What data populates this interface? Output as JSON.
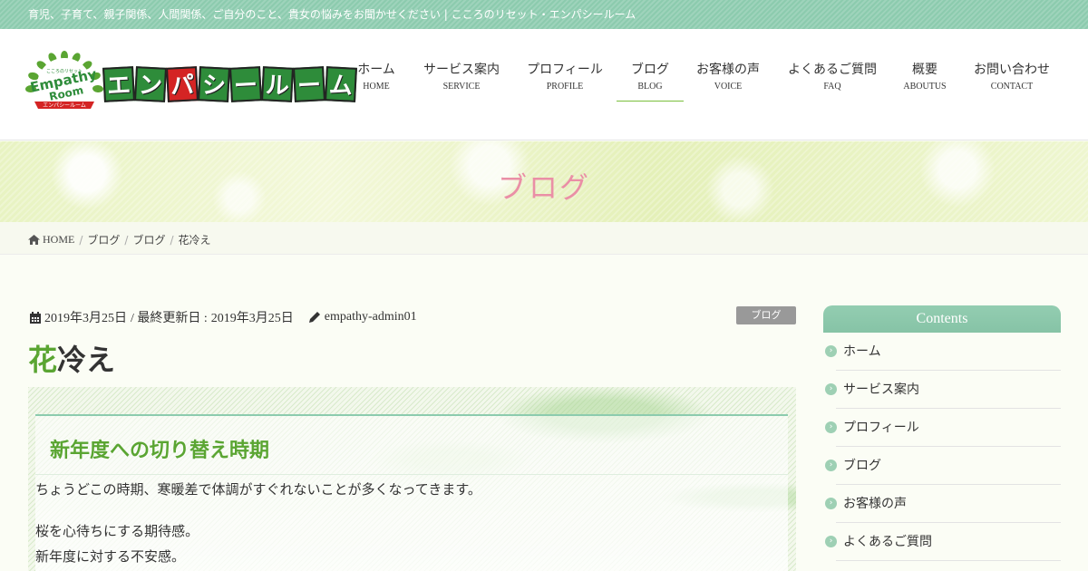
{
  "topbar": {
    "tagline": "育児、子育て、親子関係、人間関係、ご自分のこと、貴女の悩みをお聞かせください | こころのリセット・エンパシールーム"
  },
  "logo": {
    "badge_small": "こころのリセット",
    "badge_line1": "Empathy",
    "badge_line2": "Room",
    "badge_ribbon": "エンパシールーム",
    "wordmark": [
      "エ",
      "ン",
      "パ",
      "シ",
      "ー",
      "ル",
      "ー",
      "ム"
    ]
  },
  "nav": [
    {
      "jp": "ホーム",
      "en": "HOME"
    },
    {
      "jp": "サービス案内",
      "en": "SERVICE"
    },
    {
      "jp": "プロフィール",
      "en": "PROFILE"
    },
    {
      "jp": "ブログ",
      "en": "BLOG",
      "active": true
    },
    {
      "jp": "お客様の声",
      "en": "VOICE"
    },
    {
      "jp": "よくあるご質問",
      "en": "FAQ"
    },
    {
      "jp": "概要",
      "en": "ABOUTUS"
    },
    {
      "jp": "お問い合わせ",
      "en": "CONTACT"
    }
  ],
  "hero": {
    "title": "ブログ"
  },
  "breadcrumb": {
    "home": "HOME",
    "c1": "ブログ",
    "c2": "ブログ",
    "current": "花冷え"
  },
  "meta": {
    "published": "2019年3月25日",
    "updated_label": "/ 最終更新日 :",
    "updated": "2019年3月25日",
    "author": "empathy-admin01",
    "category": "ブログ"
  },
  "post": {
    "title_first": "花",
    "title_rest": "冷え",
    "heading": "新年度への切り替え時期",
    "p1": "ちょうどこの時期、寒暖差で体調がすぐれないことが多くなってきます。",
    "p2": "桜を心待ちにする期待感。",
    "p3": "新年度に対する不安感。"
  },
  "sidebar": {
    "title": "Contents",
    "items": [
      "ホーム",
      "サービス案内",
      "プロフィール",
      "ブログ",
      "お客様の声",
      "よくあるご質問"
    ]
  },
  "colors": {
    "accent_green": "#5aa532",
    "hero_pink": "#ea8fa6",
    "mint": "#8ccbae"
  }
}
